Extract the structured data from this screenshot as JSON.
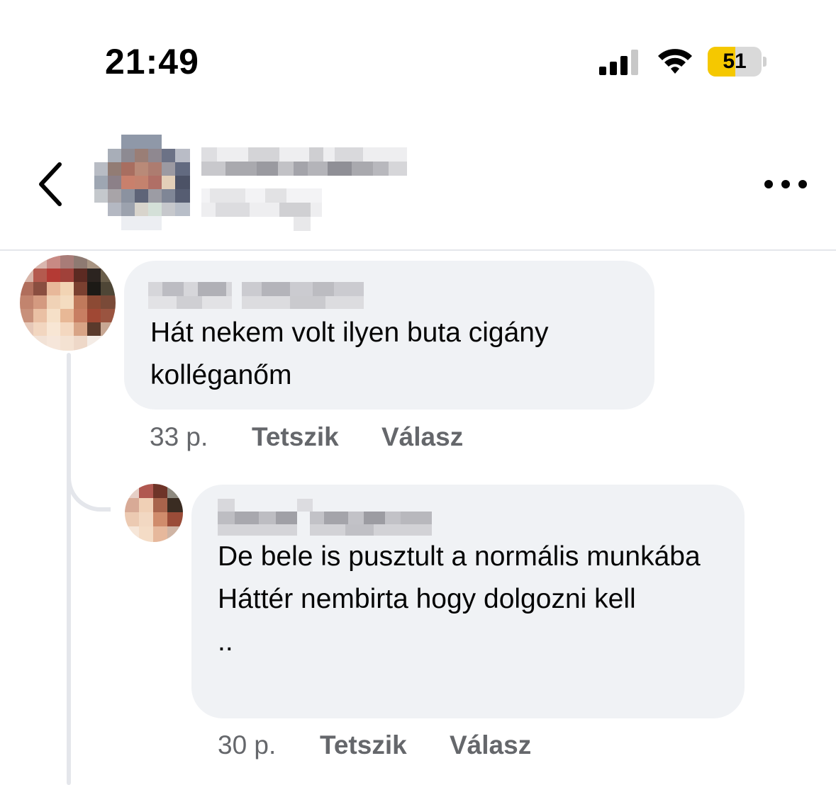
{
  "status_bar": {
    "time": "21:49",
    "battery": "51",
    "battery_level": 0.51,
    "icons": [
      "signal-icon",
      "wifi-icon",
      "battery-icon"
    ]
  },
  "header": {
    "icons": [
      "chevron-left-icon",
      "more-horizontal-icon"
    ]
  },
  "comments": [
    {
      "text": "Hát  nekem volt ilyen buta cigány kolléganőm",
      "age": "33 p.",
      "like_label": "Tetszik",
      "reply_label": "Válasz"
    },
    {
      "text": "De bele is pusztult a normális munkába\nHáttér nembirta hogy dolgozni kell\n..",
      "age": "30 p.",
      "like_label": "Tetszik",
      "reply_label": "Válasz"
    }
  ],
  "colors": {
    "bubble": "#f0f2f5",
    "secondary_text": "#65676b",
    "battery_fill": "#f5c800",
    "thread_line": "#e4e6eb"
  }
}
